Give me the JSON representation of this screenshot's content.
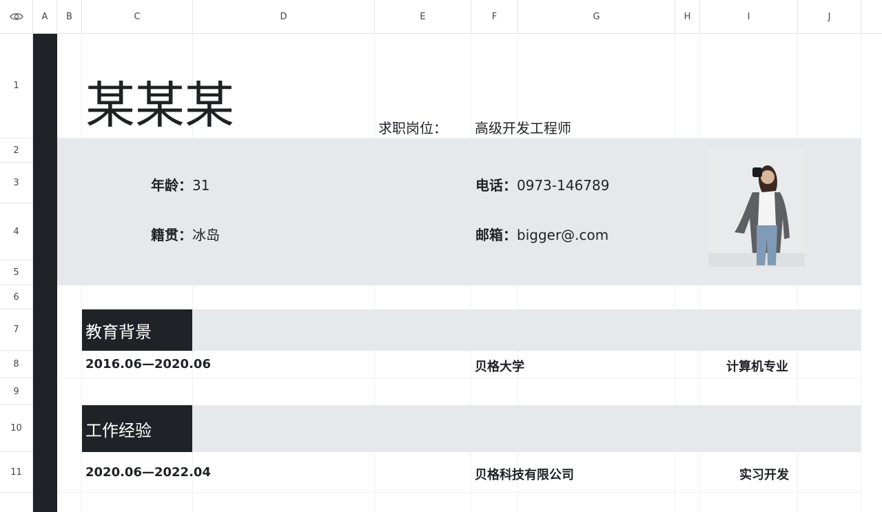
{
  "sheet": {
    "columns": [
      "A",
      "B",
      "C",
      "D",
      "E",
      "F",
      "G",
      "H",
      "I",
      "J"
    ],
    "rows": [
      "1",
      "2",
      "3",
      "4",
      "5",
      "6",
      "7",
      "8",
      "9",
      "10",
      "11"
    ]
  },
  "resume": {
    "name": "某某某",
    "job_label": "求职岗位：",
    "job_value": "高级开发工程师",
    "age_label": "年龄：",
    "age_value": "31",
    "origin_label": "籍贯：",
    "origin_value": "冰岛",
    "phone_label": "电话：",
    "phone_value": "0973-146789",
    "email_label": "邮箱：",
    "email_value": "bigger@.com",
    "education": {
      "title": "教育背景",
      "period": "2016.06—2020.06",
      "school": "贝格大学",
      "major": "计算机专业"
    },
    "work": {
      "title": "工作经验",
      "period": "2020.06—2022.04",
      "company": "贝格科技有限公司",
      "role": "实习开发"
    }
  },
  "colors": {
    "dark": "#1f2226",
    "band": "#e6e8ec"
  }
}
